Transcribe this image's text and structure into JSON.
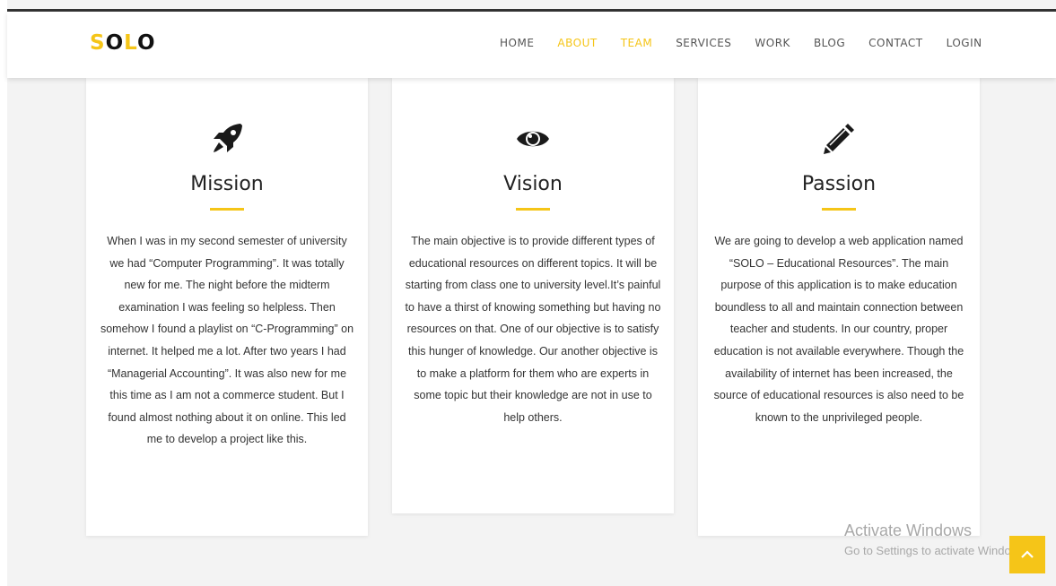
{
  "logo": {
    "s": "S",
    "o1": "O",
    "l": "L",
    "o2": "O"
  },
  "nav": {
    "items": [
      {
        "label": "HOME",
        "active": false
      },
      {
        "label": "ABOUT",
        "active": true
      },
      {
        "label": "TEAM",
        "active": true
      },
      {
        "label": "SERVICES",
        "active": false
      },
      {
        "label": "WORK",
        "active": false
      },
      {
        "label": "BLOG",
        "active": false
      },
      {
        "label": "CONTACT",
        "active": false
      },
      {
        "label": "LOGIN",
        "active": false
      }
    ]
  },
  "colors": {
    "accent": "#f5c518",
    "text": "#333333",
    "background": "#f3f3f3"
  },
  "cards": [
    {
      "icon": "rocket-icon",
      "title": "Mission",
      "text": "When I was in my second semester of university we had “Computer Programming”. It was totally new for me. The night before the midterm examination I was feeling so helpless. Then somehow I found a playlist on “C-Programming” on internet. It helped me a lot. After two years I had “Managerial Accounting”. It was also new for me this time as I am not a commerce student. But I found almost nothing about it on online. This led me to develop a project like this."
    },
    {
      "icon": "eye-icon",
      "title": "Vision",
      "text": "The main objective is to provide different types of educational resources on different topics. It will be starting from class one to university level.It’s painful to have a thirst of knowing something but having no resources on that. One of our objective is to satisfy this hunger of knowledge. Our another objective is to make a platform for them who are experts in some topic but their knowledge are not in use to help others."
    },
    {
      "icon": "pencil-icon",
      "title": "Passion",
      "text": "We are going to develop a web application named “SOLO – Educational Resources”. The main purpose of this application is to make education boundless to all and maintain connection between teacher and students. In our country, proper education is not available everywhere. Though the availability of internet has been increased, the source of educational resources is also need to be known to the unprivileged people."
    }
  ],
  "watermark": {
    "line1": "Activate Windows",
    "line2": "Go to Settings to activate Windows."
  },
  "scroll_top": {
    "icon": "chevron-up-icon"
  }
}
